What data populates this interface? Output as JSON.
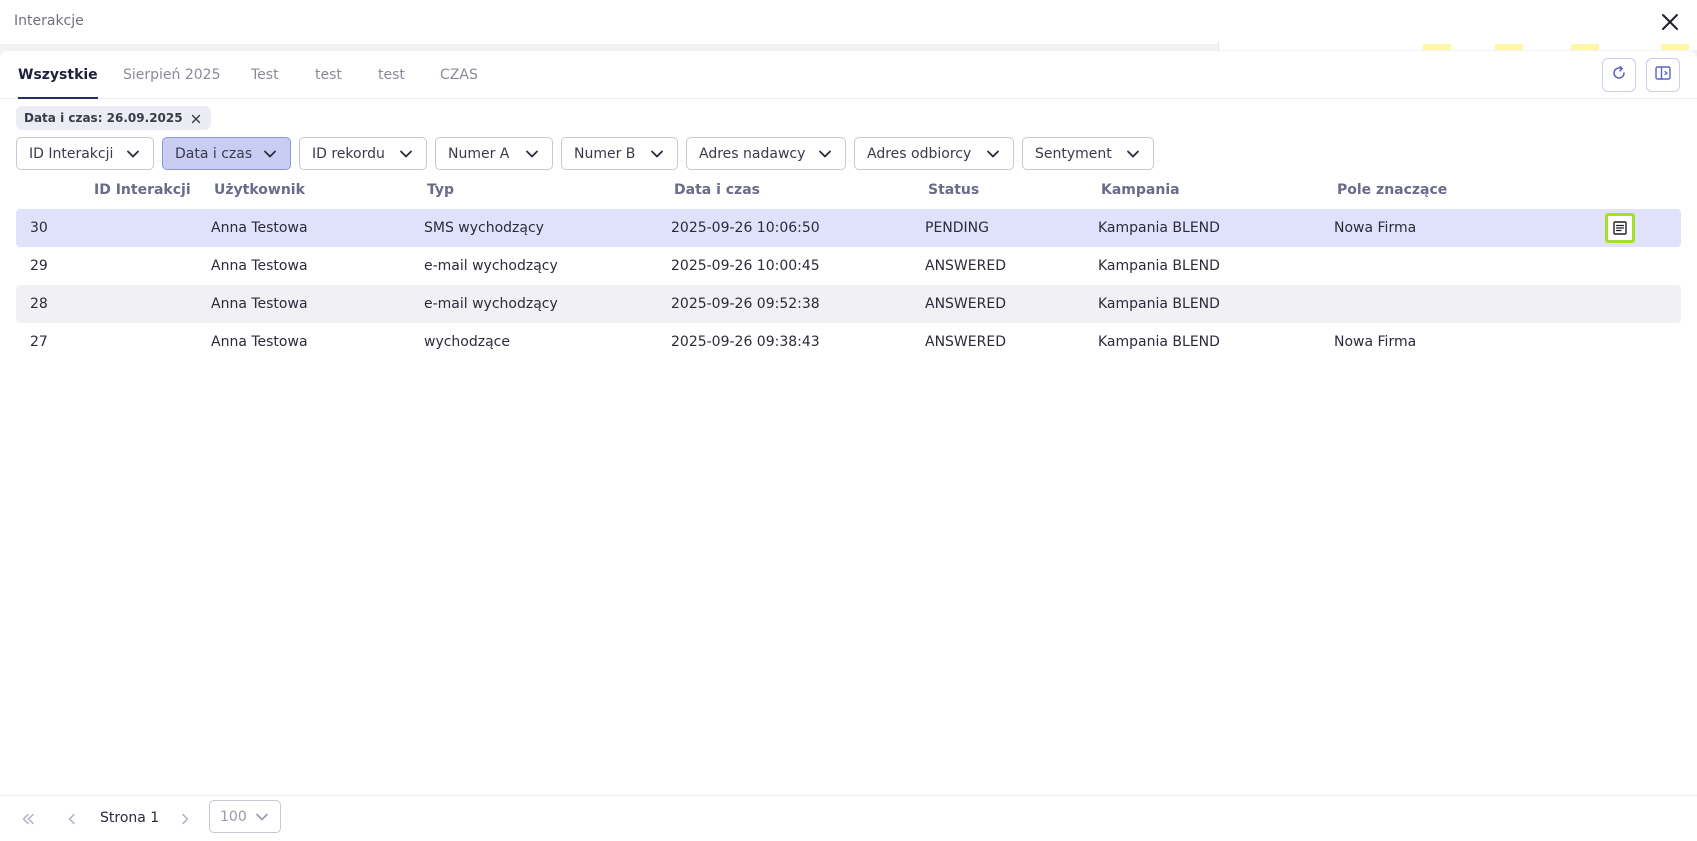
{
  "window": {
    "title": "Interakcje"
  },
  "tabs": [
    {
      "label": "Wszystkie",
      "active": true
    },
    {
      "label": "Sierpień 2025",
      "active": false
    },
    {
      "label": "Test",
      "active": false
    },
    {
      "label": "test",
      "active": false
    },
    {
      "label": "test",
      "active": false
    },
    {
      "label": "CZAS",
      "active": false
    }
  ],
  "active_filter_chip": {
    "label": "Data i czas: 26.09.2025"
  },
  "filters": [
    {
      "label": "ID Interakcji",
      "active": false
    },
    {
      "label": "Data i czas",
      "active": true
    },
    {
      "label": "ID rekordu",
      "active": false
    },
    {
      "label": "Numer A",
      "active": false
    },
    {
      "label": "Numer B",
      "active": false
    },
    {
      "label": "Adres nadawcy",
      "active": false
    },
    {
      "label": "Adres odbiorcy",
      "active": false
    },
    {
      "label": "Sentyment",
      "active": false
    }
  ],
  "table": {
    "columns": [
      "ID Interakcji",
      "Użytkownik",
      "Typ",
      "Data i czas",
      "Status",
      "Kampania",
      "Pole znaczące"
    ],
    "rows": [
      {
        "id": "30",
        "user": "Anna Testowa",
        "type": "SMS wychodzący",
        "datetime": "2025-09-26 10:06:50",
        "status": "PENDING",
        "campaign": "Kampania BLEND",
        "field": "Nowa Firma"
      },
      {
        "id": "29",
        "user": "Anna Testowa",
        "type": "e-mail wychodzący",
        "datetime": "2025-09-26 10:00:45",
        "status": "ANSWERED",
        "campaign": "Kampania BLEND",
        "field": ""
      },
      {
        "id": "28",
        "user": "Anna Testowa",
        "type": "e-mail wychodzący",
        "datetime": "2025-09-26 09:52:38",
        "status": "ANSWERED",
        "campaign": "Kampania BLEND",
        "field": ""
      },
      {
        "id": "27",
        "user": "Anna Testowa",
        "type": "wychodzące",
        "datetime": "2025-09-26 09:38:43",
        "status": "ANSWERED",
        "campaign": "Kampania BLEND",
        "field": "Nowa Firma"
      }
    ]
  },
  "pagination": {
    "page_label": "Strona 1",
    "page_size": "100"
  },
  "icons": {
    "close": "close-icon",
    "refresh": "refresh-icon",
    "panel": "panel-toggle-icon",
    "row_details": "document-icon",
    "chip_remove": "close-icon",
    "filter_toggle": "chevron-down-icon",
    "first_page": "double-chevron-left-icon",
    "prev_page": "chevron-left-icon",
    "next_page": "chevron-right-icon"
  },
  "colors": {
    "accent": "#2b2b6a",
    "active_filter_bg": "#c9cdf4",
    "selected_row_bg": "#e0e2fb",
    "focus_outline": "#a5e02a"
  }
}
